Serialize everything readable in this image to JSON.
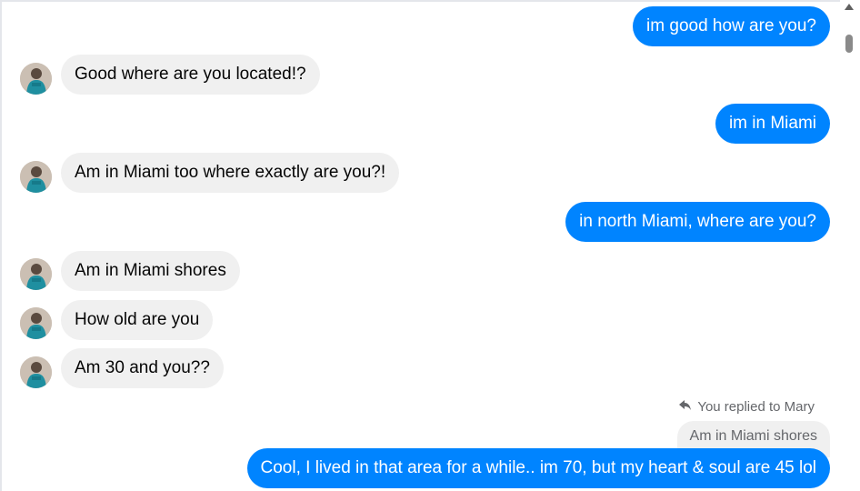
{
  "contact_name": "Mary",
  "messages": [
    {
      "from": "me",
      "text": "im good how are you?"
    },
    {
      "from": "contact",
      "text": "Good where are you located!?"
    },
    {
      "from": "me",
      "text": "im in Miami"
    },
    {
      "from": "contact",
      "text": "Am in Miami too where exactly are you?!"
    },
    {
      "from": "me",
      "text": "in north Miami, where are you?"
    },
    {
      "from": "contact",
      "text": "Am in Miami shores"
    },
    {
      "from": "contact",
      "text": "How old are you"
    },
    {
      "from": "contact",
      "text": "Am 30 and you??"
    },
    {
      "from": "me",
      "text": "Cool, I lived in that area for a while..  im 70, but my heart & soul are 45  lol"
    }
  ],
  "reply": {
    "label": "You replied to Mary",
    "quoted_text": "Am in Miami shores"
  },
  "colors": {
    "outgoing_bubble": "#0084ff",
    "incoming_bubble": "#f0f0f0"
  },
  "icons": {
    "reply": "reply-arrow-icon",
    "scroll_up": "scroll-up-arrow-icon"
  }
}
